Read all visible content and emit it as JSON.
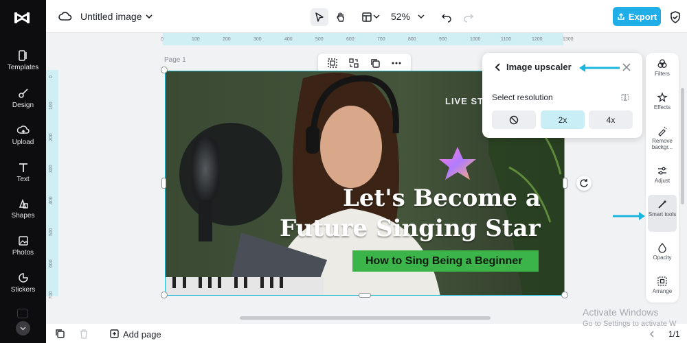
{
  "app": {
    "doc_title": "Untitled image",
    "zoom": "52%",
    "export_label": "Export",
    "colors": {
      "accent": "#1faee8",
      "selection": "#19b7d2",
      "sidebar": "#0d0d0f"
    }
  },
  "sidebar": {
    "items": [
      {
        "label": "Templates",
        "icon": "templates-icon"
      },
      {
        "label": "Design",
        "icon": "design-icon"
      },
      {
        "label": "Upload",
        "icon": "upload-icon"
      },
      {
        "label": "Text",
        "icon": "text-icon"
      },
      {
        "label": "Shapes",
        "icon": "shapes-icon"
      },
      {
        "label": "Photos",
        "icon": "photos-icon"
      },
      {
        "label": "Stickers",
        "icon": "stickers-icon"
      }
    ]
  },
  "ruler": {
    "top_ticks": [
      "0",
      "100",
      "200",
      "300",
      "400",
      "500",
      "600",
      "700",
      "800",
      "900",
      "1000",
      "1100",
      "1200",
      "1300"
    ],
    "left_ticks": [
      "0",
      "100",
      "200",
      "300",
      "400",
      "500",
      "600",
      "700"
    ]
  },
  "canvas": {
    "page_label": "Page 1",
    "live_text": "LIVE ST",
    "headline_line1": "Let's Become a",
    "headline_line2": "Future Singing Star",
    "subheadline": "How to Sing Being a Beginner"
  },
  "upscaler": {
    "title": "Image upscaler",
    "subtitle": "Select resolution",
    "options": [
      "2x",
      "4x"
    ],
    "selected": "2x"
  },
  "rail": {
    "items": [
      {
        "label": "Filters",
        "icon": "filters-icon"
      },
      {
        "label": "Effects",
        "icon": "effects-icon"
      },
      {
        "label": "Remove backgr...",
        "icon": "remove-background-icon"
      },
      {
        "label": "Adjust",
        "icon": "adjust-icon"
      },
      {
        "label": "Smart tools",
        "icon": "smart-tools-icon"
      },
      {
        "label": "Opacity",
        "icon": "opacity-icon"
      },
      {
        "label": "Arrange",
        "icon": "arrange-icon"
      }
    ]
  },
  "bottom": {
    "add_page": "Add page",
    "pager": "1/1"
  },
  "watermark": {
    "line1": "Activate Windows",
    "line2": "Go to Settings to activate W"
  }
}
